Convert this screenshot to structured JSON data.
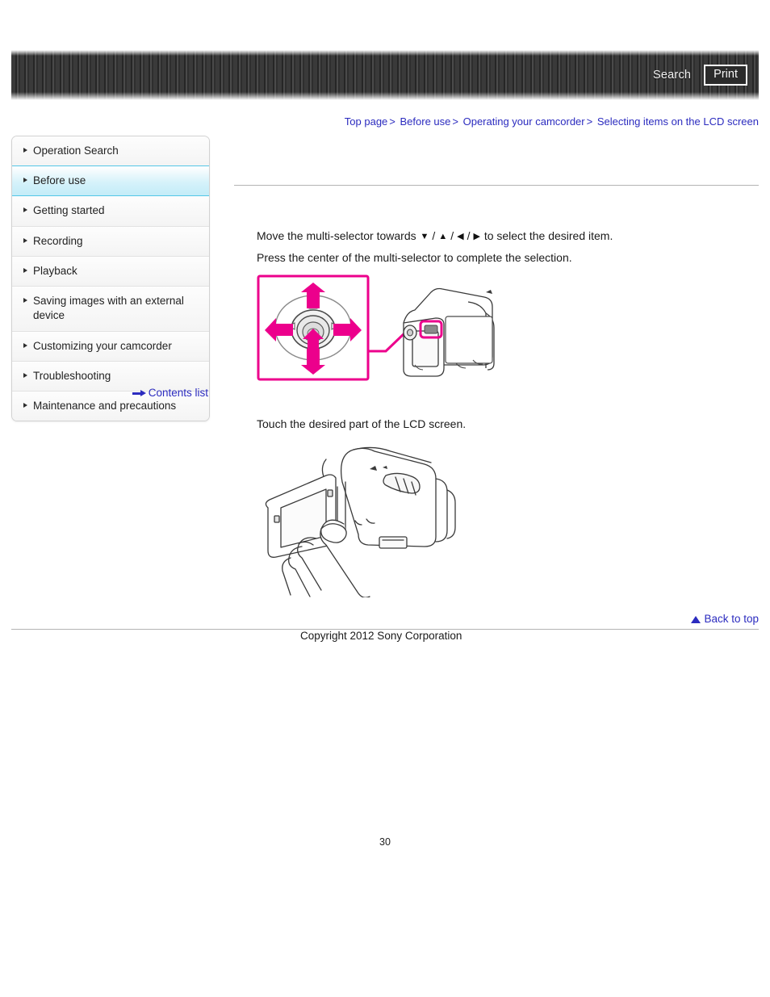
{
  "header": {
    "search_label": "Search",
    "print_label": "Print",
    "search_icon": "search-icon",
    "stripe_color": "#333333"
  },
  "breadcrumb": {
    "separator": ">",
    "items": [
      {
        "label": "Top page"
      },
      {
        "label": "Before use"
      },
      {
        "label": "Operating your camcorder"
      },
      {
        "label": "Selecting items on the LCD screen"
      }
    ],
    "link_color": "#2b2bbf"
  },
  "sidebar": {
    "items": [
      {
        "label": "Operation Search",
        "active": false
      },
      {
        "label": "Before use",
        "active": true
      },
      {
        "label": "Getting started",
        "active": false
      },
      {
        "label": "Recording",
        "active": false
      },
      {
        "label": "Playback",
        "active": false
      },
      {
        "label": "Saving images with an external device",
        "active": false
      },
      {
        "label": "Customizing your camcorder",
        "active": false
      },
      {
        "label": "Troubleshooting",
        "active": false
      },
      {
        "label": "Maintenance and precautions",
        "active": false
      }
    ],
    "active_color": "#c3ecf8",
    "contents_list_label": "Contents list",
    "contents_list_icon": "arrow-right-icon"
  },
  "main": {
    "paragraph_move_prefix": "Move the multi-selector towards",
    "paragraph_move_suffix": "to select the desired item.",
    "direction_glyphs": [
      "▼",
      "▲",
      "◀",
      "▶"
    ],
    "paragraph_press": "Press the center of the multi-selector to complete the selection.",
    "paragraph_touch": "Touch the desired part of the LCD screen.",
    "figure_multiselector_name": "multi-selector-diagram",
    "figure_touch_name": "touch-lcd-diagram",
    "accent_magenta": "#ec008c"
  },
  "footer": {
    "back_to_top_label": "Back to top",
    "back_to_top_icon": "triangle-up-icon",
    "copyright": "Copyright 2012 Sony Corporation",
    "page_number": "30"
  }
}
